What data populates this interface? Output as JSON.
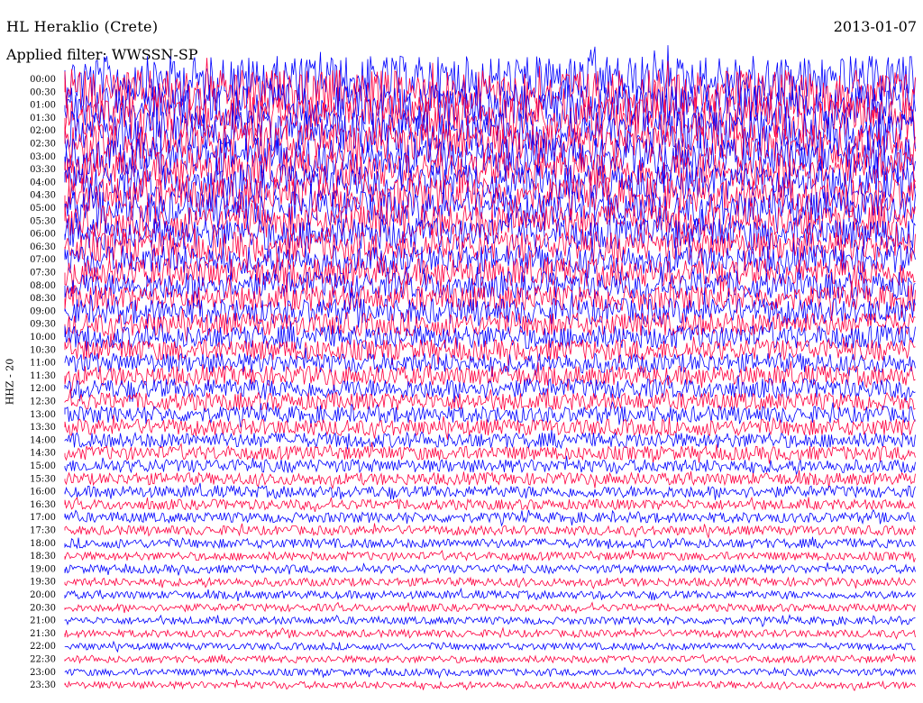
{
  "header": {
    "station": "HL Heraklio (Crete)",
    "date": "2013-01-07",
    "filter": "Applied filter: WWSSN-SP"
  },
  "chart_data": {
    "type": "line",
    "title": "HL Heraklio (Crete)",
    "subtitle": "Applied filter: WWSSN-SP",
    "date": "2013-01-07",
    "ylabel": "HHZ - 20",
    "xlabel": "",
    "colors": [
      "#0000ff",
      "#ff0040"
    ],
    "rows": [
      "00:00",
      "00:30",
      "01:00",
      "01:30",
      "02:00",
      "02:30",
      "03:00",
      "03:30",
      "04:00",
      "04:30",
      "05:00",
      "05:30",
      "06:00",
      "06:30",
      "07:00",
      "07:30",
      "08:00",
      "08:30",
      "09:00",
      "09:30",
      "10:00",
      "10:30",
      "11:00",
      "11:30",
      "12:00",
      "12:30",
      "13:00",
      "13:30",
      "14:00",
      "14:30",
      "15:00",
      "15:30",
      "16:00",
      "16:30",
      "17:00",
      "17:30",
      "18:00",
      "18:30",
      "19:00",
      "19:30",
      "20:00",
      "20:30",
      "21:00",
      "21:30",
      "22:00",
      "22:30",
      "23:00",
      "23:30"
    ],
    "amplitude": [
      1.0,
      0.95,
      0.9,
      0.92,
      0.85,
      0.85,
      0.8,
      0.75,
      0.75,
      0.75,
      0.72,
      0.7,
      0.68,
      0.65,
      0.62,
      0.6,
      0.58,
      0.55,
      0.55,
      0.5,
      0.5,
      0.45,
      0.42,
      0.42,
      0.42,
      0.38,
      0.35,
      0.35,
      0.32,
      0.3,
      0.28,
      0.26,
      0.25,
      0.22,
      0.22,
      0.2,
      0.2,
      0.18,
      0.18,
      0.18,
      0.17,
      0.16,
      0.16,
      0.16,
      0.15,
      0.15,
      0.15,
      0.15
    ],
    "grid": false,
    "legend": "none"
  }
}
